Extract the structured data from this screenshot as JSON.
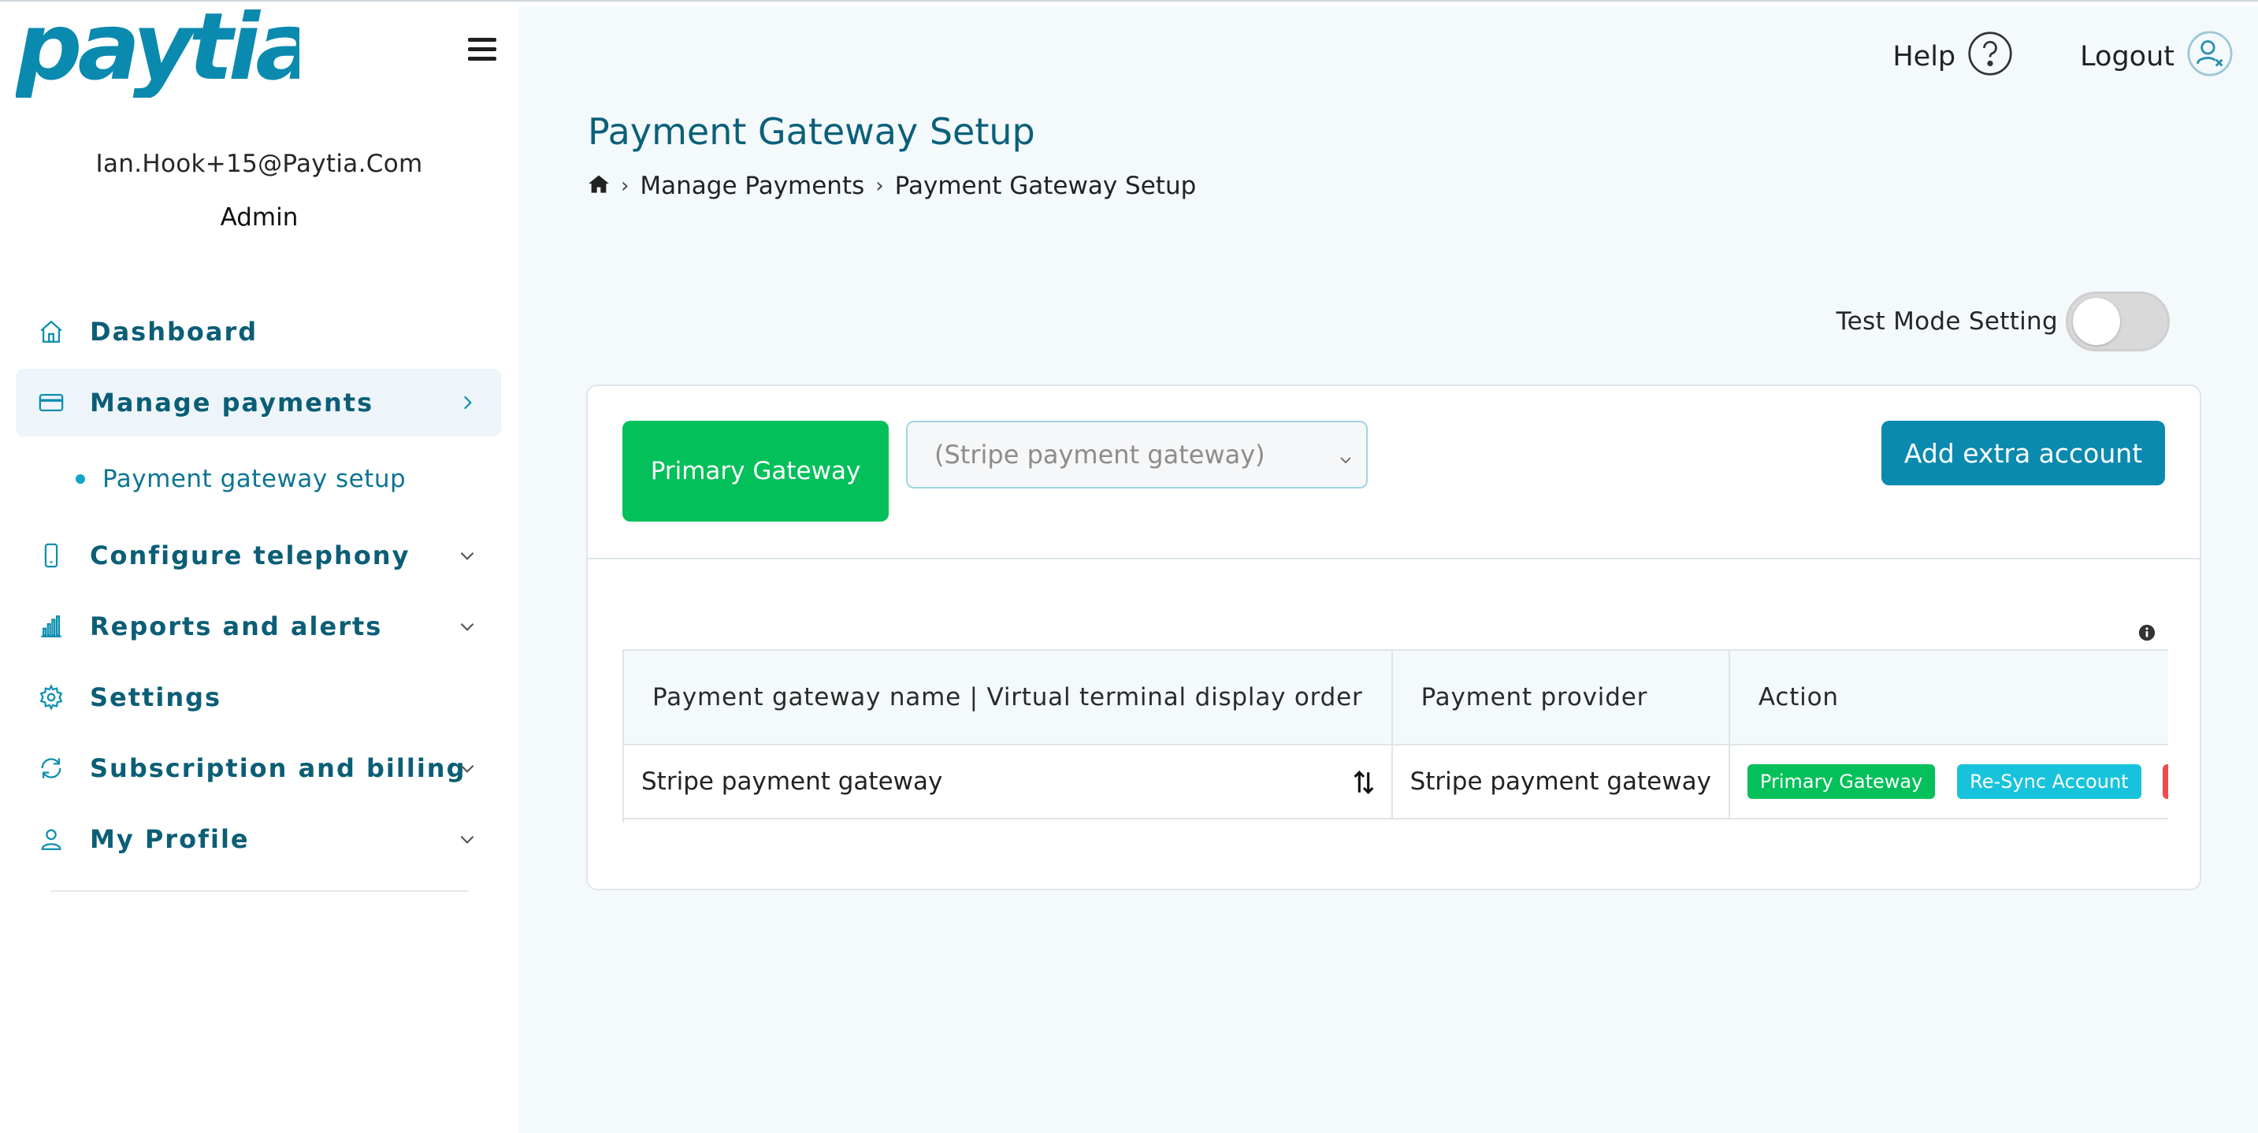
{
  "sidebar": {
    "logo_text": "paytia",
    "user_email": "Ian.Hook+15@Paytia.Com",
    "user_role": "Admin",
    "items": [
      {
        "label": "Dashboard",
        "icon": "home-icon"
      },
      {
        "label": "Manage payments",
        "icon": "credit-card-icon"
      },
      {
        "label": "Configure telephony",
        "icon": "phone-icon"
      },
      {
        "label": "Reports and alerts",
        "icon": "bar-chart-icon"
      },
      {
        "label": "Settings",
        "icon": "gear-icon"
      },
      {
        "label": "Subscription and billing",
        "icon": "refresh-icon"
      },
      {
        "label": "My Profile",
        "icon": "user-icon"
      }
    ],
    "subitem": {
      "label": "Payment gateway setup"
    }
  },
  "header": {
    "help": "Help",
    "logout": "Logout"
  },
  "page": {
    "title": "Payment Gateway Setup",
    "breadcrumb": [
      "Manage Payments",
      "Payment Gateway Setup"
    ],
    "test_mode_label": "Test Mode Setting",
    "test_mode_on": false
  },
  "card": {
    "primary_gateway_button": "Primary Gateway",
    "gateway_select_value": "(Stripe payment gateway)",
    "add_extra_button": "Add extra account"
  },
  "table": {
    "headers": [
      "Payment gateway name | Virtual terminal display order",
      "Payment provider",
      "Action"
    ],
    "rows": [
      {
        "name": "Stripe payment gateway",
        "provider": "Stripe payment gateway",
        "actions": [
          "Primary Gateway",
          "Re-Sync Account",
          ""
        ]
      }
    ]
  },
  "colors": {
    "brand": "#0b8ab0",
    "nav_text": "#0b5e76",
    "success": "#03c05a",
    "info": "#17c3dc",
    "danger": "#f04b4b"
  }
}
